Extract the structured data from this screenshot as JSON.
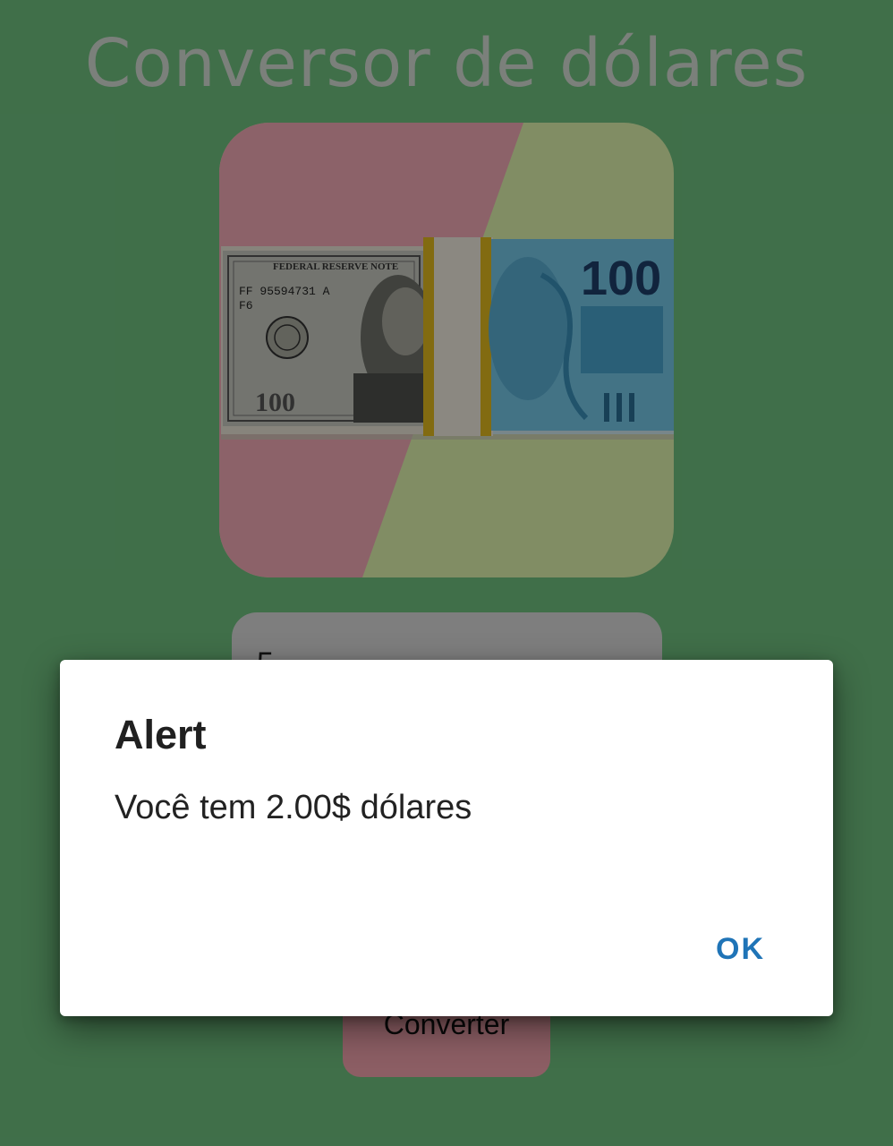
{
  "app": {
    "title": "Conversor de dólares",
    "background_color": "#6fbf7f"
  },
  "hero_image": {
    "description_icon": "money-bills-image",
    "dollar_note": {
      "denomination": "100",
      "header": "FEDERAL RESERVE NOTE",
      "serial": "FF 95594731 A",
      "code": "F6"
    },
    "real_note": {
      "denomination": "100"
    }
  },
  "input": {
    "value": "5"
  },
  "convert_button": {
    "label": "Converter",
    "color": "#f2a3ad"
  },
  "alert": {
    "title": "Alert",
    "message": "Você tem 2.00$ dólares",
    "ok_label": "OK",
    "ok_color": "#1f74b7"
  }
}
